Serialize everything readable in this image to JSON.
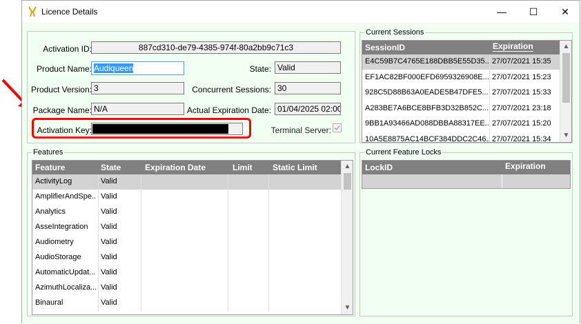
{
  "window": {
    "title": "Licence Details",
    "minimize_glyph": "—",
    "maximize_glyph": "☐",
    "close_glyph": "✕"
  },
  "licence": {
    "activation_id_label": "Activation ID:",
    "activation_id": "887cd310-de79-4385-974f-80a2bb9c71c3",
    "product_name_label": "Product Name:",
    "product_name": "Audiqueen",
    "state_label": "State:",
    "state": "Valid",
    "product_version_label": "Product Version:",
    "product_version": "3",
    "concurrent_sessions_label": "Concurrent Sessions:",
    "concurrent_sessions": "30",
    "package_name_label": "Package Name:",
    "package_name": "N/A",
    "actual_expiration_label": "Actual Expiration Date:",
    "actual_expiration": "01/04/2025 02:00",
    "activation_key_label": "Activation Key:",
    "terminal_server_label": "Terminal Server:",
    "terminal_server_checked": true
  },
  "current_sessions": {
    "title": "Current Sessions",
    "columns": [
      "SessionID",
      "Expiration"
    ],
    "rows": [
      {
        "id": "E4C59B7C4765E188DBB5E55D35...",
        "exp": "27/07/2021 15:35"
      },
      {
        "id": "EF1AC82BF000EFD6959326908E...",
        "exp": "27/07/2021 15:23"
      },
      {
        "id": "928C5D88B63A0EADE5B47DFE5...",
        "exp": "27/07/2021 15:33"
      },
      {
        "id": "A283BE7A6BCE8BFB3D32B852C...",
        "exp": "27/07/2021 23:18"
      },
      {
        "id": "9BB1A93466AD088DBBA88317EE...",
        "exp": "27/07/2021 15:20"
      },
      {
        "id": "10A5E8875AC14BCF384DDC2C46...",
        "exp": "27/07/2021 15:34"
      }
    ]
  },
  "features": {
    "title": "Features",
    "columns": [
      "Feature",
      "State",
      "Expiration Date",
      "Limit",
      "Static Limit"
    ],
    "rows": [
      {
        "name": "ActivityLog",
        "state": "Valid"
      },
      {
        "name": "AmplifierAndSpe...",
        "state": "Valid"
      },
      {
        "name": "Analytics",
        "state": "Valid"
      },
      {
        "name": "AsseIntegration",
        "state": "Valid"
      },
      {
        "name": "Audiometry",
        "state": "Valid"
      },
      {
        "name": "AudioStorage",
        "state": "Valid"
      },
      {
        "name": "AutomaticUpdat...",
        "state": "Valid"
      },
      {
        "name": "AzimuthLocaliza...",
        "state": "Valid"
      },
      {
        "name": "Binaural",
        "state": "Valid"
      }
    ]
  },
  "feature_locks": {
    "title": "Current Feature Locks",
    "columns": [
      "LockID",
      "Expiration"
    ]
  },
  "scroll": {
    "up": "▲",
    "down": "▼"
  },
  "colors": {
    "highlight": "#ff0000",
    "selection": "#3399ff",
    "header": "#808080",
    "client_bg": "#f0fff0"
  }
}
